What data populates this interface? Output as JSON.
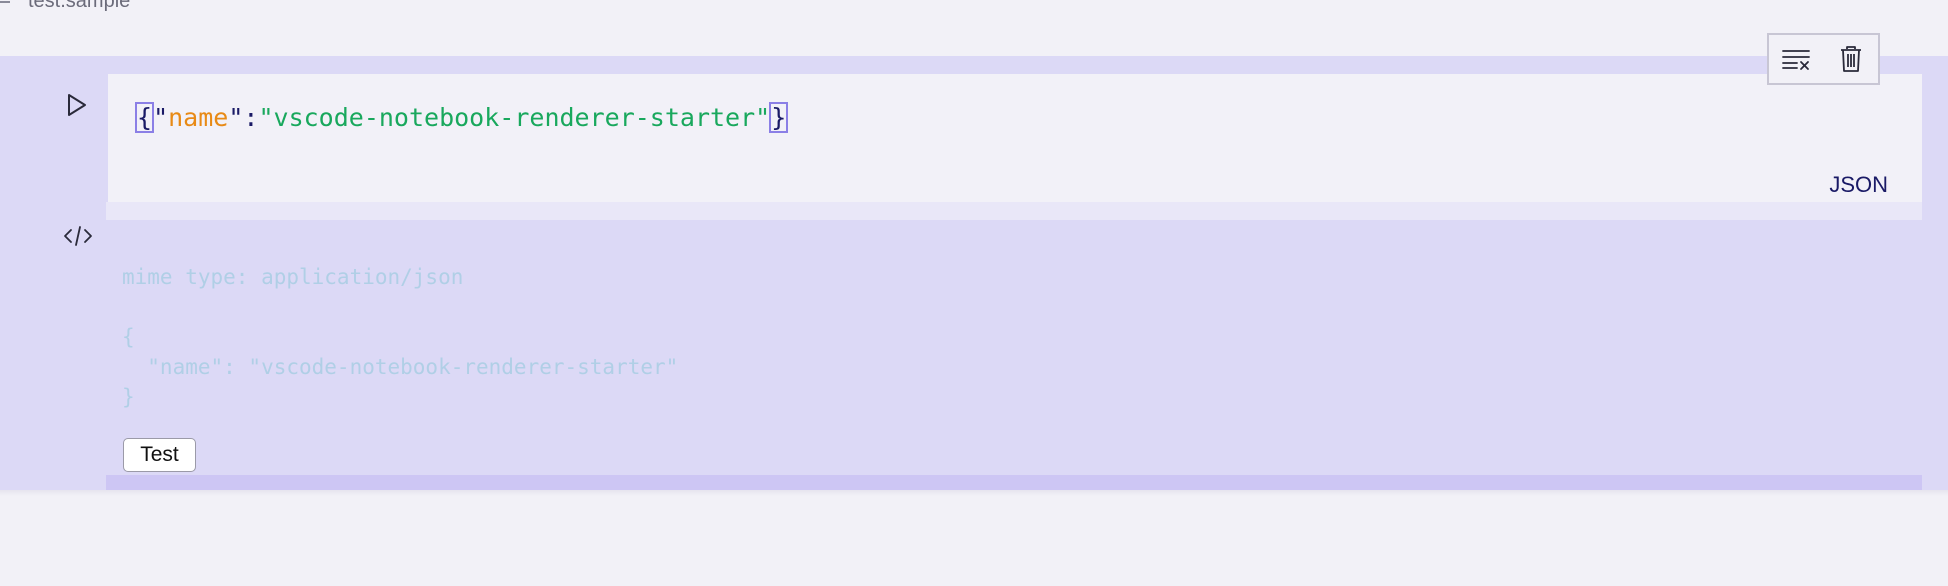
{
  "notebook": {
    "title": "test.sample"
  },
  "cell": {
    "code": {
      "open_brace": "{",
      "quote1": "\"",
      "key": "name",
      "quote2": "\"",
      "colon": ":",
      "value": "\"vscode-notebook-renderer-starter\"",
      "close_brace": "}"
    },
    "language": "JSON",
    "toolbar": {
      "clear_outputs_icon": "clear-all-icon",
      "delete_icon": "trash-icon"
    },
    "run_icon": "play-icon",
    "output_toggle_icon": "code-icon"
  },
  "output": {
    "mime_line": "mime type: application/json",
    "json_lines": [
      "{",
      "  \"name\": \"vscode-notebook-renderer-starter\"",
      "}"
    ],
    "button_label": "Test"
  },
  "colors": {
    "cell_background": "#dcd9f6",
    "json_key": "#e88a16",
    "json_string": "#19a85d",
    "output_text": "#b0cfe6"
  }
}
